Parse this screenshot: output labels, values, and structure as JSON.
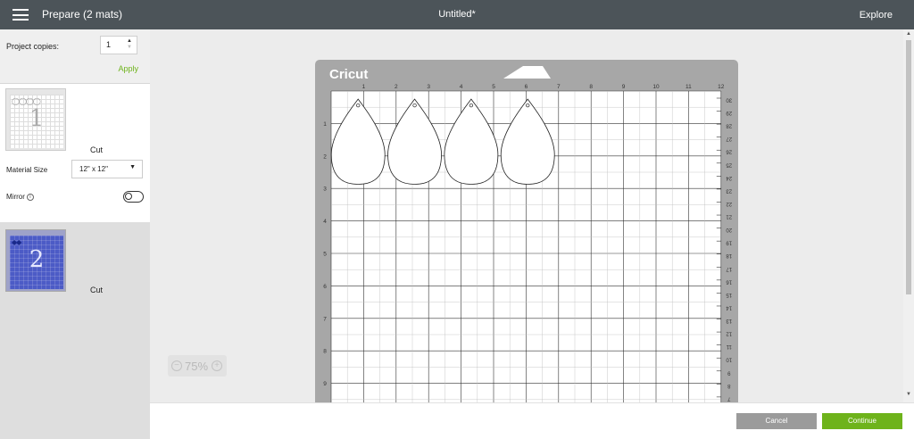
{
  "header": {
    "title": "Prepare (2 mats)",
    "document": "Untitled*",
    "machine": "Explore"
  },
  "sidebar": {
    "copies_label": "Project copies:",
    "copies_value": "1",
    "apply_label": "Apply",
    "mats": [
      {
        "number": "1",
        "mode": "Cut",
        "material_size_label": "Material Size",
        "material_size": "12\" x 12\"",
        "mirror_label": "Mirror"
      },
      {
        "number": "2",
        "mode": "Cut"
      }
    ]
  },
  "mat": {
    "brand": "Cricut",
    "top_ruler": [
      "1",
      "2",
      "3",
      "4",
      "5",
      "6",
      "7",
      "8",
      "9",
      "10",
      "11",
      "12"
    ],
    "left_ruler": [
      "1",
      "2",
      "3",
      "4",
      "5",
      "6",
      "7",
      "8",
      "9"
    ],
    "right_ruler": [
      "30",
      "29",
      "28",
      "27",
      "26",
      "25",
      "24",
      "23",
      "22",
      "21",
      "20",
      "19",
      "18",
      "17",
      "16",
      "15",
      "14",
      "13",
      "12",
      "11",
      "10",
      "9",
      "8",
      "7"
    ],
    "shape_count": 4,
    "grid_color": "#ffffff",
    "mat_color": "#a7a7a7"
  },
  "zoom": {
    "value": "75%"
  },
  "footer": {
    "cancel_label": "Cancel",
    "continue_label": "Continue"
  },
  "colors": {
    "accent": "#6eb31b",
    "topbar": "#4c5459",
    "mat2_blue": "#4c5bc6"
  }
}
